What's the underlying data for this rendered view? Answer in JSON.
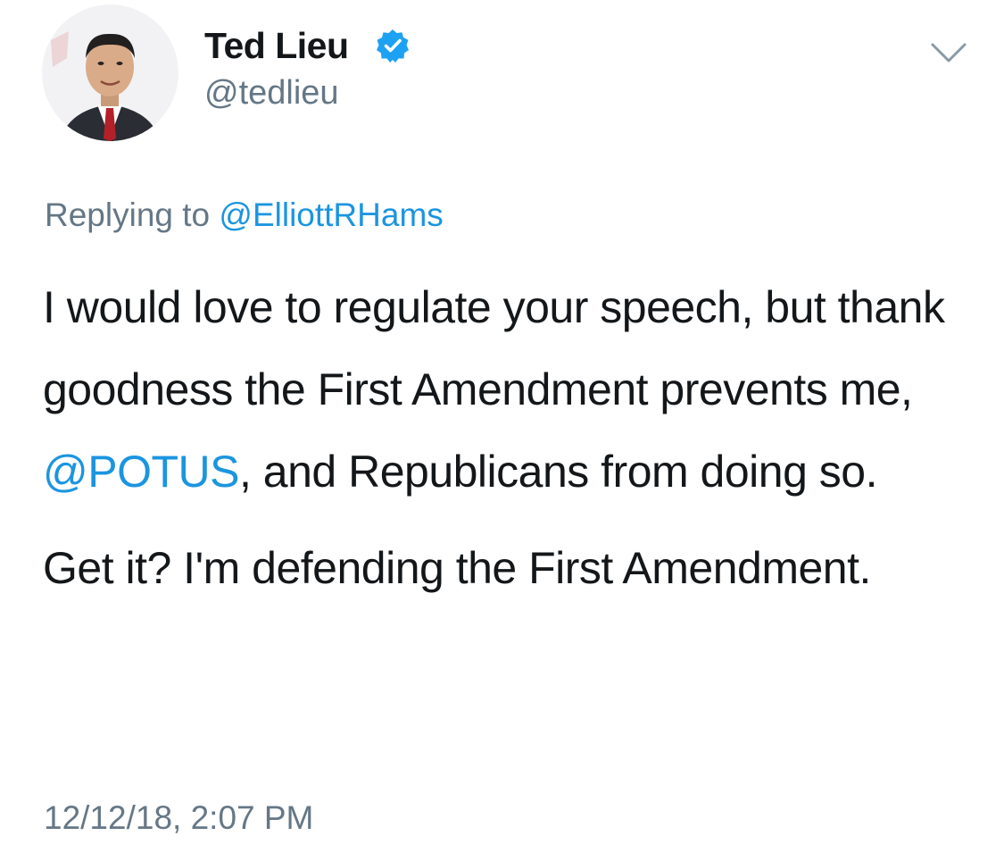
{
  "author": {
    "display_name": "Ted Lieu",
    "handle": "@tedlieu",
    "verified_icon": "verified-badge-icon"
  },
  "menu": {
    "icon": "chevron-down-icon"
  },
  "reply": {
    "prefix": "Replying to",
    "mention": "@ElliottRHams"
  },
  "tweet": {
    "para1_before": "I would love to regulate your speech, but thank goodness the First Amendment prevents me, ",
    "para1_mention": "@POTUS",
    "para1_after": ", and Republicans from doing so.",
    "para2": "Get it? I'm defending the First Amendment."
  },
  "timestamp": "12/12/18, 2:07 PM",
  "colors": {
    "text": "#14171a",
    "secondary": "#657786",
    "link": "#1b95e0",
    "verified": "#1da1f2"
  }
}
